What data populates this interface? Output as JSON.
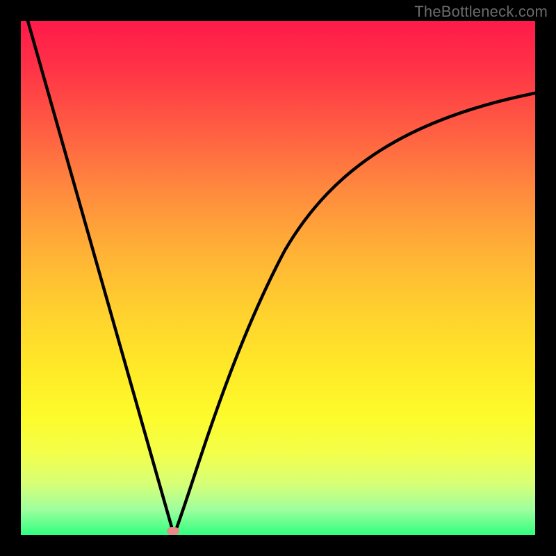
{
  "watermark": "TheBottleneck.com",
  "colors": {
    "frame": "#000000",
    "curve": "#000000",
    "marker": "#e98a88",
    "gradient_top": "#ff1a4a",
    "gradient_bottom": "#2fff7f"
  },
  "chart_data": {
    "type": "line",
    "title": "",
    "xlabel": "",
    "ylabel": "",
    "xlim": [
      0,
      100
    ],
    "ylim": [
      0,
      100
    ],
    "grid": false,
    "legend": false,
    "series": [
      {
        "name": "left-branch",
        "x": [
          1,
          4,
          8,
          12,
          16,
          20,
          24,
          27,
          29.5
        ],
        "y": [
          100,
          88,
          76,
          62,
          48,
          35,
          22,
          10,
          1
        ]
      },
      {
        "name": "right-branch",
        "x": [
          29.5,
          31,
          33,
          36,
          40,
          45,
          52,
          60,
          70,
          82,
          100
        ],
        "y": [
          1,
          8,
          18,
          30,
          43,
          55,
          65,
          73,
          79,
          83,
          86
        ]
      }
    ],
    "marker": {
      "x": 29.5,
      "y": 1,
      "shape": "ellipse"
    }
  }
}
